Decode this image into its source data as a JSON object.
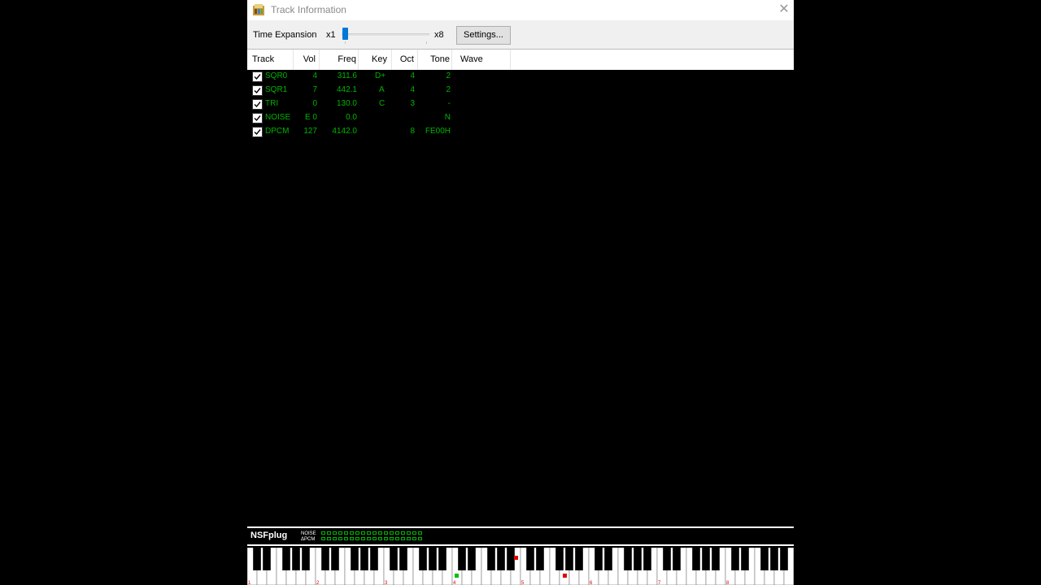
{
  "window": {
    "title": "Track Information",
    "close_icon": "close-icon",
    "app_icon": "app-icon"
  },
  "toolbar": {
    "time_expansion_label": "Time Expansion",
    "slider_min_label": "x1",
    "slider_max_label": "x8",
    "slider_value_fraction": 0.0,
    "settings_label": "Settings..."
  },
  "table": {
    "columns": [
      "Track",
      "Vol",
      "Freq",
      "Key",
      "Oct",
      "Tone",
      "Wave"
    ],
    "rows": [
      {
        "checked": true,
        "track": "SQR0",
        "vol": "4",
        "freq": "311.6",
        "key": "D+",
        "oct": "4",
        "tone": "2"
      },
      {
        "checked": true,
        "track": "SQR1",
        "vol": "7",
        "freq": "442.1",
        "key": "A",
        "oct": "4",
        "tone": "2"
      },
      {
        "checked": true,
        "track": "TRI",
        "vol": "0",
        "freq": "130.0",
        "key": "C",
        "oct": "3",
        "tone": "-"
      },
      {
        "checked": true,
        "track": "NOISE",
        "vol": "E 0",
        "freq": "0.0",
        "key": "",
        "oct": "",
        "tone": "N"
      },
      {
        "checked": true,
        "track": "DPCM",
        "vol": "127",
        "freq": "4142.0",
        "key": "",
        "oct": "8",
        "tone": "FE00H"
      }
    ]
  },
  "status": {
    "logo": "NSFplug",
    "noise_label": "NOISE",
    "dpcm_label": "ΔPCM"
  },
  "piano": {
    "octave_labels": [
      "1",
      "2",
      "3",
      "4",
      "5",
      "6",
      "7",
      "8"
    ],
    "active_keys": [
      {
        "note": "SQR0",
        "color": "#e00000"
      },
      {
        "note": "SQR1",
        "color": "#e00000"
      },
      {
        "note": "TRI",
        "color": "#00c000"
      }
    ]
  },
  "colors": {
    "channel_text": "#00b400",
    "accent": "#0078d7"
  }
}
